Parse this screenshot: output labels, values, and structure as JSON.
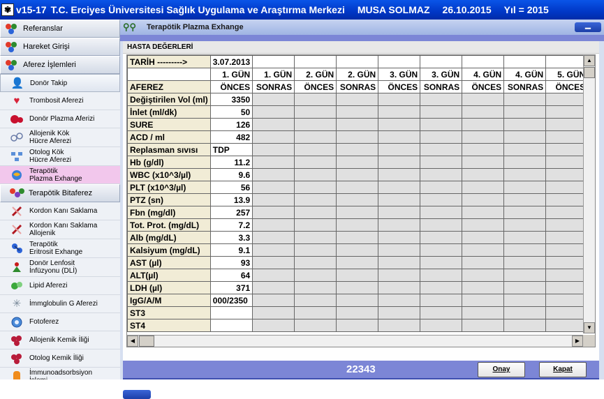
{
  "titlebar": {
    "version": "v15-17",
    "institution": "T.C. Erciyes Üniversitesi Sağlık Uygulama ve Araştırma Merkezi",
    "user": "MUSA SOLMAZ",
    "date": "26.10.2015",
    "year": "Yıl = 2015"
  },
  "sidebar": {
    "items": [
      {
        "label": "Referanslar",
        "icon": "molecule-icon"
      },
      {
        "label": "Hareket Girişi",
        "icon": "molecule-icon"
      },
      {
        "label": "Aferez İşlemleri",
        "icon": "molecule-icon"
      },
      {
        "label": "Donör Takip",
        "icon": "person-icon"
      },
      {
        "label": "Trombosit Aferezi",
        "icon": "heart-card-icon"
      },
      {
        "label": "Donör Plazma Aferizi",
        "icon": "blood-drops-icon"
      },
      {
        "label": "Allojenik Kök\nHücre Aferezi",
        "icon": "cells-icon"
      },
      {
        "label": "Otolog Kök\nHücre Aferezi",
        "icon": "cells-network-icon"
      },
      {
        "label": "Terapötik\nPlazma Exhange",
        "icon": "globe-icon"
      },
      {
        "label": "Terapötik Bitaferez",
        "icon": "molecule-colored-icon"
      },
      {
        "label": "Kordon Kanı Saklama",
        "icon": "cord-icon"
      },
      {
        "label": "Kordon Kanı Saklama\nAllojenik",
        "icon": "cord-icon"
      },
      {
        "label": "Terapötik\nEritrosit Exhange",
        "icon": "molecule-blue-icon"
      },
      {
        "label": "Donör Lenfosit\nİnfüzyonu (DLİ)",
        "icon": "lymphocyte-icon"
      },
      {
        "label": "Lipid Aferezi",
        "icon": "lipid-icon"
      },
      {
        "label": "İmmglobulin G Aferezi",
        "icon": "antibody-icon"
      },
      {
        "label": "Fotoferez",
        "icon": "photo-icon"
      },
      {
        "label": "Allojenik Kemik İliği",
        "icon": "bone-marrow-icon"
      },
      {
        "label": "Otolog Kemik İliği",
        "icon": "bone-marrow-icon"
      },
      {
        "label": "İmmunoadsorbsiyon\nİşlemi",
        "icon": "pill-icon"
      }
    ]
  },
  "window": {
    "title": "Terapötik Plazma Exhange",
    "panel_title": "HASTA DEĞERLERİ",
    "record_count": "22343",
    "confirm_label": "Onay",
    "close_label": "Kapat"
  },
  "grid": {
    "date_row": {
      "label": "TARİH --------->",
      "value": "3.07.2013"
    },
    "day_headers": [
      "1. GÜN",
      "1. GÜN",
      "2. GÜN",
      "2. GÜN",
      "3. GÜN",
      "3. GÜN",
      "4. GÜN",
      "4. GÜN",
      "5. GÜN"
    ],
    "phase_row": {
      "label": "AFEREZ",
      "phases": [
        "ÖNCES",
        "SONRAS",
        "ÖNCES",
        "SONRAS",
        "ÖNCES",
        "SONRAS",
        "ÖNCES",
        "SONRAS",
        "ÖNCES"
      ]
    },
    "rows": [
      {
        "label": "Değiştirilen Vol (ml)",
        "value": "3350"
      },
      {
        "label": "İnlet (ml/dk)",
        "value": "50"
      },
      {
        "label": "SURE",
        "value": "126"
      },
      {
        "label": "ACD / ml",
        "value": "482"
      },
      {
        "label": "Replasman sıvısı",
        "value": "TDP"
      },
      {
        "label": "Hb (g/dl)",
        "value": "11.2"
      },
      {
        "label": "WBC (x10^3/µl)",
        "value": "9.6"
      },
      {
        "label": "PLT (x10^3/µl)",
        "value": "56"
      },
      {
        "label": "PTZ (sn)",
        "value": "13.9"
      },
      {
        "label": "Fbn (mg/dl)",
        "value": "257"
      },
      {
        "label": "Tot. Prot. (mg/dL)",
        "value": "7.2"
      },
      {
        "label": "Alb (mg/dL)",
        "value": "3.3"
      },
      {
        "label": "Kalsiyum (mg/dL)",
        "value": "9.1"
      },
      {
        "label": "AST (µl)",
        "value": "93"
      },
      {
        "label": "ALT(µl)",
        "value": "64"
      },
      {
        "label": "LDH (µl)",
        "value": "371"
      },
      {
        "label": "IgG/A/M",
        "value": "000/2350"
      },
      {
        "label": "ST3",
        "value": ""
      },
      {
        "label": "ST4",
        "value": ""
      }
    ]
  },
  "colors": {
    "titlebar": "#0037c6",
    "label_column": "#f1ecd6",
    "empty_cell": "#e0e0e0",
    "footer": "#7c86d6",
    "active_sidebar": "#f2c7ec"
  }
}
